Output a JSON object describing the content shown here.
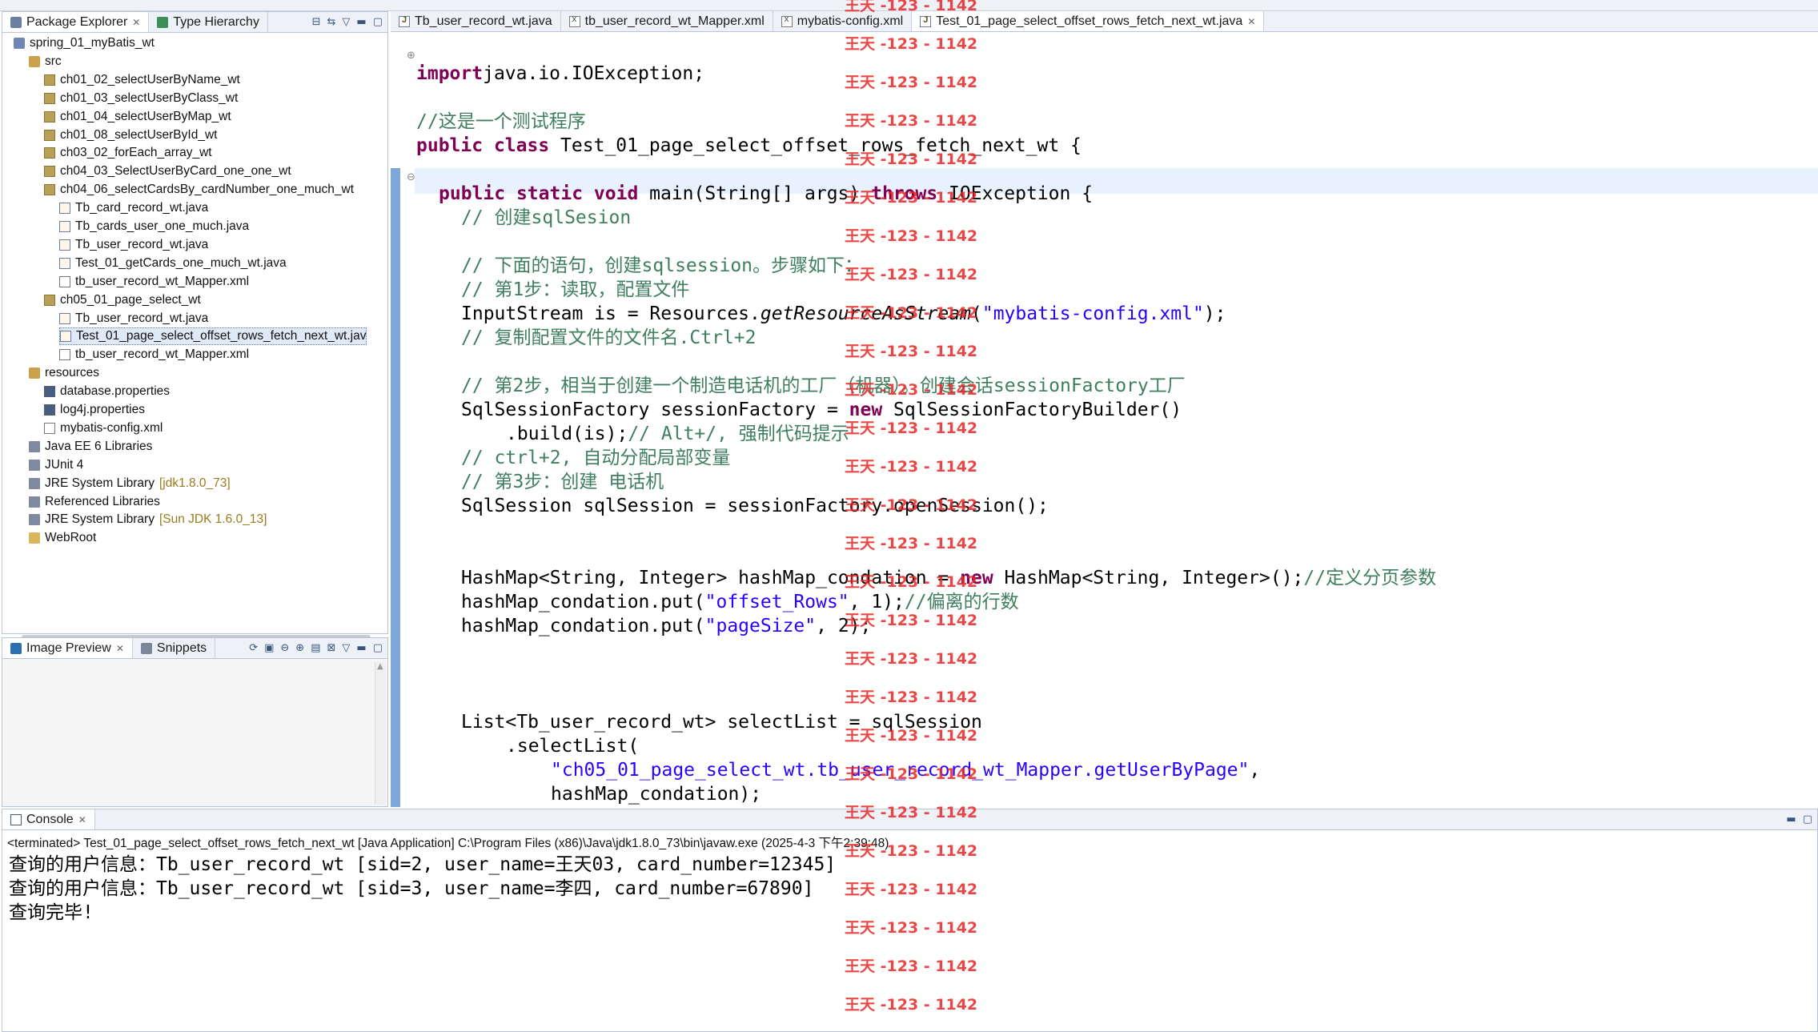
{
  "package_explorer": {
    "tabs": [
      {
        "label": "Package Explorer",
        "icon": "package-explorer-icon"
      },
      {
        "label": "Type Hierarchy",
        "icon": "type-hierarchy-icon"
      }
    ],
    "tree": [
      {
        "label": "spring_01_myBatis_wt",
        "level": 1,
        "icon": "project-icon"
      },
      {
        "label": "src",
        "level": 2,
        "icon": "source-folder-icon"
      },
      {
        "label": "ch01_02_selectUserByName_wt",
        "level": 3,
        "icon": "package-icon"
      },
      {
        "label": "ch01_03_selectUserByClass_wt",
        "level": 3,
        "icon": "package-icon"
      },
      {
        "label": "ch01_04_selectUserByMap_wt",
        "level": 3,
        "icon": "package-icon"
      },
      {
        "label": "ch01_08_selectUserById_wt",
        "level": 3,
        "icon": "package-icon"
      },
      {
        "label": "ch03_02_forEach_array_wt",
        "level": 3,
        "icon": "package-icon"
      },
      {
        "label": "ch04_03_SelectUserByCard_one_one_wt",
        "level": 3,
        "icon": "package-icon"
      },
      {
        "label": "ch04_06_selectCardsBy_cardNumber_one_much_wt",
        "level": 3,
        "icon": "package-icon"
      },
      {
        "label": "Tb_card_record_wt.java",
        "level": 4,
        "icon": "java-file-icon"
      },
      {
        "label": "Tb_cards_user_one_much.java",
        "level": 4,
        "icon": "java-file-icon"
      },
      {
        "label": "Tb_user_record_wt.java",
        "level": 4,
        "icon": "java-file-icon"
      },
      {
        "label": "Test_01_getCards_one_much_wt.java",
        "level": 4,
        "icon": "java-file-icon"
      },
      {
        "label": "tb_user_record_wt_Mapper.xml",
        "level": 4,
        "icon": "xml-file-icon"
      },
      {
        "label": "ch05_01_page_select_wt",
        "level": 3,
        "icon": "package-icon"
      },
      {
        "label": "Tb_user_record_wt.java",
        "level": 4,
        "icon": "java-file-icon"
      },
      {
        "label": "Test_01_page_select_offset_rows_fetch_next_wt.jav",
        "level": 4,
        "icon": "java-file-icon",
        "selected": true
      },
      {
        "label": "tb_user_record_wt_Mapper.xml",
        "level": 4,
        "icon": "xml-file-icon"
      },
      {
        "label": "resources",
        "level": 2,
        "icon": "source-folder-icon"
      },
      {
        "label": "database.properties",
        "level": 3,
        "icon": "properties-file-icon"
      },
      {
        "label": "log4j.properties",
        "level": 3,
        "icon": "properties-file-icon"
      },
      {
        "label": "mybatis-config.xml",
        "level": 3,
        "icon": "xml-file-icon"
      },
      {
        "label": "Java EE 6 Libraries",
        "level": 2,
        "icon": "library-icon"
      },
      {
        "label": "JUnit 4",
        "level": 2,
        "icon": "library-icon"
      },
      {
        "label": "JRE System Library",
        "level": 2,
        "icon": "library-icon",
        "suffix": "[jdk1.8.0_73]"
      },
      {
        "label": "Referenced Libraries",
        "level": 2,
        "icon": "library-icon"
      },
      {
        "label": "JRE System Library",
        "level": 2,
        "icon": "library-icon",
        "suffix": "[Sun JDK 1.6.0_13]"
      },
      {
        "label": "WebRoot",
        "level": 2,
        "icon": "folder-icon"
      }
    ]
  },
  "preview_panel": {
    "tabs": [
      {
        "label": "Image Preview",
        "icon": "image-preview-icon"
      },
      {
        "label": "Snippets",
        "icon": "snippets-icon"
      }
    ]
  },
  "editor": {
    "tabs": [
      {
        "label": "Tb_user_record_wt.java",
        "icon": "java-file-icon"
      },
      {
        "label": "tb_user_record_wt_Mapper.xml",
        "icon": "xml-file-icon"
      },
      {
        "label": "mybatis-config.xml",
        "icon": "xml-file-icon"
      },
      {
        "label": "Test_01_page_select_offset_rows_fetch_next_wt.java",
        "icon": "java-file-icon",
        "active": true
      }
    ],
    "lines": [
      {
        "row": 0,
        "indent": 0,
        "parts": [
          [
            "kw",
            "import"
          ],
          [
            "",
            "java.io.IOException;"
          ]
        ]
      },
      {
        "row": 2,
        "indent": 0,
        "parts": [
          [
            "cm",
            "//这是一个测试程序"
          ]
        ]
      },
      {
        "row": 3,
        "indent": 0,
        "parts": [
          [
            "kw",
            "public"
          ],
          [
            "",
            " "
          ],
          [
            "kw",
            "class"
          ],
          [
            "",
            " Test_01_page_select_offset_rows_fetch_next_wt {"
          ]
        ]
      },
      {
        "row": 5,
        "indent": 1,
        "parts": [
          [
            "kw",
            "public"
          ],
          [
            "",
            " "
          ],
          [
            "kw",
            "static"
          ],
          [
            "",
            " "
          ],
          [
            "kw",
            "void"
          ],
          [
            "",
            " main(String[] args) "
          ],
          [
            "kw",
            "throws"
          ],
          [
            "",
            " IOException {"
          ]
        ]
      },
      {
        "row": 6,
        "indent": 2,
        "parts": [
          [
            "cm",
            "// 创建sqlSesion"
          ]
        ]
      },
      {
        "row": 8,
        "indent": 2,
        "parts": [
          [
            "cm",
            "// 下面的语句，创建sqlsession。步骤如下："
          ]
        ]
      },
      {
        "row": 9,
        "indent": 2,
        "parts": [
          [
            "cm",
            "// 第1步：读取，配置文件"
          ]
        ]
      },
      {
        "row": 10,
        "indent": 2,
        "parts": [
          [
            "",
            "InputStream is = Resources."
          ],
          [
            "it",
            "getResourceAsStream"
          ],
          [
            "",
            "("
          ],
          [
            "st",
            "\"mybatis-config.xml\""
          ],
          [
            "",
            ");"
          ]
        ]
      },
      {
        "row": 11,
        "indent": 2,
        "parts": [
          [
            "cm",
            "// 复制配置文件的文件名.Ctrl+2"
          ]
        ]
      },
      {
        "row": 13,
        "indent": 2,
        "parts": [
          [
            "cm",
            "// 第2步，相当于创建一个制造电话机的工厂（机器）。创建会话sessionFactory工厂"
          ]
        ]
      },
      {
        "row": 14,
        "indent": 2,
        "parts": [
          [
            "",
            "SqlSessionFactory sessionFactory = "
          ],
          [
            "kw",
            "new"
          ],
          [
            "",
            " SqlSessionFactoryBuilder()"
          ]
        ]
      },
      {
        "row": 15,
        "indent": 4,
        "parts": [
          [
            "",
            ".build(is);"
          ],
          [
            "cm",
            "// Alt+/, 强制代码提示"
          ]
        ]
      },
      {
        "row": 16,
        "indent": 2,
        "parts": [
          [
            "cm",
            "// ctrl+2, 自动分配局部变量"
          ]
        ]
      },
      {
        "row": 17,
        "indent": 2,
        "parts": [
          [
            "cm",
            "// 第3步：创建 电话机"
          ]
        ]
      },
      {
        "row": 18,
        "indent": 2,
        "parts": [
          [
            "",
            "SqlSession sqlSession = sessionFactory.openSession();"
          ]
        ]
      },
      {
        "row": 21,
        "indent": 2,
        "parts": [
          [
            "",
            "HashMap<String, Integer> hashMap_condation = "
          ],
          [
            "kw",
            "new"
          ],
          [
            "",
            " HashMap<String, Integer>();"
          ],
          [
            "cm",
            "//定义分页参数"
          ]
        ]
      },
      {
        "row": 22,
        "indent": 2,
        "parts": [
          [
            "",
            "hashMap_condation.put("
          ],
          [
            "st",
            "\"offset_Rows\""
          ],
          [
            "",
            ", 1);"
          ],
          [
            "cm",
            "//偏离的行数"
          ]
        ]
      },
      {
        "row": 23,
        "indent": 2,
        "parts": [
          [
            "",
            "hashMap_condation.put("
          ],
          [
            "st",
            "\"pageSize\""
          ],
          [
            "",
            ", 2);"
          ]
        ]
      },
      {
        "row": 27,
        "indent": 2,
        "parts": [
          [
            "",
            "List<Tb_user_record_wt> selectList = sqlSession"
          ]
        ]
      },
      {
        "row": 28,
        "indent": 4,
        "parts": [
          [
            "",
            ".selectList("
          ]
        ]
      },
      {
        "row": 29,
        "indent": 6,
        "parts": [
          [
            "st",
            "\"ch05_01_page_select_wt.tb_user_record_wt_Mapper.getUserByPage\""
          ],
          [
            "",
            ","
          ]
        ]
      },
      {
        "row": 30,
        "indent": 6,
        "parts": [
          [
            "",
            "hashMap_condation);"
          ]
        ]
      }
    ]
  },
  "console": {
    "tab_label": "Console",
    "status": "<terminated> Test_01_page_select_offset_rows_fetch_next_wt [Java Application] C:\\Program Files (x86)\\Java\\jdk1.8.0_73\\bin\\javaw.exe (2025-4-3 下午2:39:48)",
    "output": [
      "查询的用户信息：Tb_user_record_wt [sid=2, user_name=王天03, card_number=12345]",
      "查询的用户信息：Tb_user_record_wt [sid=3, user_name=李四, card_number=67890]",
      "查询完毕!"
    ]
  },
  "watermark": {
    "text": "王天 -123 - 1142",
    "color": "#e62828"
  }
}
